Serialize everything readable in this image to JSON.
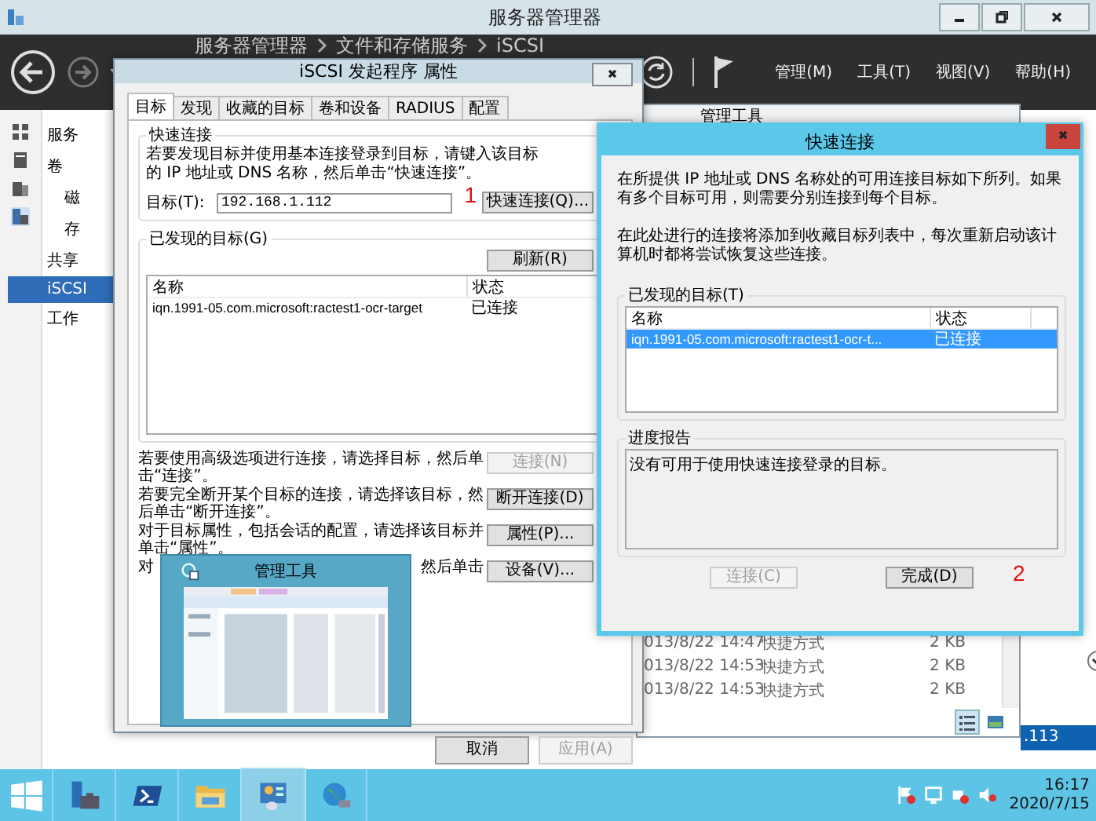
{
  "server_manager": {
    "title": "服务器管理器",
    "breadcrumb": [
      "服务器管理器",
      "文件和存储服务",
      "iSCSI"
    ],
    "menu": [
      "管理(M)",
      "工具(T)",
      "视图(V)",
      "帮助(H)"
    ],
    "nav": [
      {
        "label": "服务",
        "selected": false
      },
      {
        "label": "卷",
        "selected": false,
        "children": [
          {
            "label": "磁",
            "selected": false
          },
          {
            "label": "存",
            "selected": false
          }
        ]
      },
      {
        "label": "共享",
        "selected": false
      },
      {
        "label": "iSCSI",
        "selected": true
      },
      {
        "label": "工作",
        "selected": false
      }
    ],
    "selected_row": ".113"
  },
  "explorer": {
    "title": "管理工具",
    "rows": [
      {
        "date": "013/8/22 14:47",
        "type": "快捷方式",
        "size": "2 KB"
      },
      {
        "date": "013/8/22 14:53",
        "type": "快捷方式",
        "size": "2 KB"
      },
      {
        "date": "013/8/22 14:53",
        "type": "快捷方式",
        "size": "2 KB"
      }
    ]
  },
  "iscsi_dialog": {
    "title": "iSCSI 发起程序 属性",
    "tabs": [
      {
        "label": "目标",
        "selected": true
      },
      {
        "label": "发现",
        "selected": false
      },
      {
        "label": "收藏的目标",
        "selected": false
      },
      {
        "label": "卷和设备",
        "selected": false
      },
      {
        "label": "RADIUS",
        "selected": false
      },
      {
        "label": "配置",
        "selected": false
      }
    ],
    "quick_connect_group": "快速连接",
    "quick_connect_text": "若要发现目标并使用基本连接登录到目标，请键入该目标的 IP 地址或 DNS 名称，然后单击“快速连接”。",
    "target_label": "目标(T):",
    "target_value": "192.168.1.112",
    "quick_connect_button": "快速连接(Q)...",
    "step_marker": "1",
    "discovered_group": "已发现的目标(G)",
    "refresh_button": "刷新(R)",
    "columns": [
      "名称",
      "状态"
    ],
    "rows": [
      {
        "name": "iqn.1991-05.com.microsoft:ractest1-ocr-target",
        "status": "已连接"
      }
    ],
    "actions": [
      {
        "text": "若要使用高级选项进行连接，请选择目标，然后单击“连接”。",
        "button": {
          "label": "连接(N)",
          "disabled": true
        }
      },
      {
        "text": "若要完全断开某个目标的连接，请选择该目标，然后单击“断开连接”。",
        "button": {
          "label": "断开连接(D)",
          "disabled": false
        }
      },
      {
        "text": "对于目标属性，包括会话的配置，请选择该目标并单击“属性”。",
        "button": {
          "label": "属性(P)...",
          "disabled": false
        }
      },
      {
        "text": "对",
        "text_tail": "然后单击",
        "button": {
          "label": "设备(V)...",
          "disabled": false
        }
      }
    ],
    "buttons": [
      {
        "label": "取消",
        "disabled": false
      },
      {
        "label": "应用(A)",
        "disabled": true
      }
    ]
  },
  "quick_connect": {
    "title": "快速连接",
    "intro": "在所提供 IP 地址或 DNS 名称处的可用连接目标如下所列。如果有多个目标可用，则需要分别连接到每个目标。",
    "note": "在此处进行的连接将添加到收藏目标列表中，每次重新启动该计算机时都将尝试恢复这些连接。",
    "discovered_group": "已发现的目标(T)",
    "columns": [
      "名称",
      "状态"
    ],
    "rows": [
      {
        "name": "iqn.1991-05.com.microsoft:ractest1-ocr-t...",
        "status": "已连接",
        "selected": true
      }
    ],
    "progress_group": "进度报告",
    "progress_text": "没有可用于使用快速连接登录的目标。",
    "buttons": [
      {
        "label": "连接(C)",
        "disabled": true
      },
      {
        "label": "完成(D)",
        "disabled": false
      }
    ],
    "step_marker": "2"
  },
  "thumbnail": {
    "title": "管理工具"
  },
  "taskbar": {
    "items": [
      {
        "kind": "start",
        "selected": false
      },
      {
        "kind": "server",
        "selected": false
      },
      {
        "kind": "powershell",
        "selected": false
      },
      {
        "kind": "folder",
        "selected": false
      },
      {
        "kind": "control_panel",
        "selected": true
      },
      {
        "kind": "globe",
        "selected": false
      }
    ],
    "time": "16:17",
    "date": "2020/7/15"
  }
}
